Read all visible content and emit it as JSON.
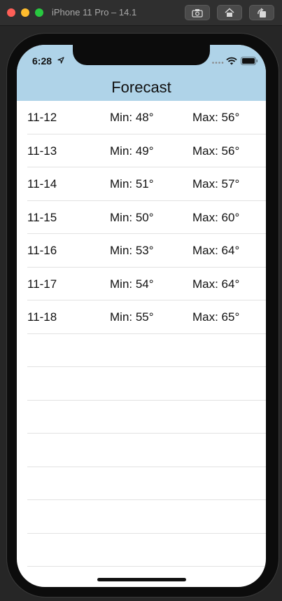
{
  "window": {
    "title": "iPhone 11 Pro – 14.1",
    "buttons": [
      "screenshot-icon",
      "home-icon",
      "rotate-icon"
    ]
  },
  "status_bar": {
    "time": "6:28"
  },
  "nav": {
    "title": "Forecast",
    "background": "#afd3e8"
  },
  "forecast": [
    {
      "date": "11-12",
      "min": "Min: 48°",
      "max": "Max: 56°"
    },
    {
      "date": "11-13",
      "min": "Min: 49°",
      "max": "Max: 56°"
    },
    {
      "date": "11-14",
      "min": "Min: 51°",
      "max": "Max: 57°"
    },
    {
      "date": "11-15",
      "min": "Min: 50°",
      "max": "Max: 60°"
    },
    {
      "date": "11-16",
      "min": "Min: 53°",
      "max": "Max: 64°"
    },
    {
      "date": "11-17",
      "min": "Min: 54°",
      "max": "Max: 64°"
    },
    {
      "date": "11-18",
      "min": "Min: 55°",
      "max": "Max: 65°"
    }
  ]
}
